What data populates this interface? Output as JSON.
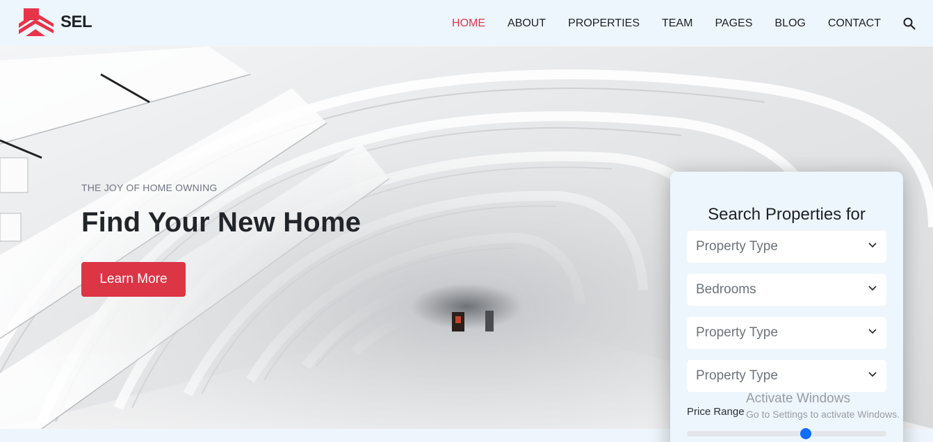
{
  "brand": {
    "name": "SEL",
    "logo_icon": "house-roof-logo-icon",
    "accent_color": "#dc3545"
  },
  "nav": {
    "items": [
      {
        "label": "HOME",
        "active": true
      },
      {
        "label": "ABOUT",
        "active": false
      },
      {
        "label": "PROPERTIES",
        "active": false
      },
      {
        "label": "TEAM",
        "active": false
      },
      {
        "label": "PAGES",
        "active": false
      },
      {
        "label": "BLOG",
        "active": false
      },
      {
        "label": "CONTACT",
        "active": false
      }
    ],
    "search_icon": "search-icon"
  },
  "hero": {
    "eyebrow": "THE JOY OF HOME OWNING",
    "title": "Find Your New Home",
    "cta_label": "Learn More"
  },
  "search_card": {
    "title": "Search Properties for",
    "selects": [
      {
        "value": "Property Type"
      },
      {
        "value": "Bedrooms"
      },
      {
        "value": "Property Type"
      },
      {
        "value": "Property Type"
      }
    ],
    "price_range_label": "Price Range",
    "price_range_fraction": 0.6,
    "slider_color": "#0d6efd"
  },
  "watermark": {
    "title": "Activate Windows",
    "subtitle": "Go to Settings to activate Windows."
  }
}
